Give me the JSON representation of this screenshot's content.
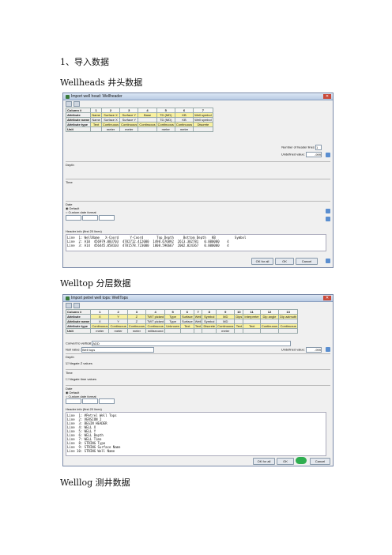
{
  "headings": {
    "import": "1、导入数据",
    "wellheads": "Wellheads 井头数据",
    "welltop": "Welltop 分层数据",
    "welllog": "Welllog 测井数据"
  },
  "dlg1": {
    "title": "Import well head: Wellheader",
    "grid": {
      "col_label": "Column #",
      "cols": [
        "1",
        "2",
        "3",
        "4",
        "5",
        "6",
        "7"
      ],
      "attr_label": "Attribute",
      "attrs": [
        "Name",
        "Surface X",
        "Surface Y",
        "Base",
        "TD (MD)",
        "KB",
        "Well symbol"
      ],
      "name_label": "Attribute name",
      "names": [
        "Name",
        "Surface X",
        "Surface Y",
        "",
        "TD (MD)",
        "KB",
        "Well symbol"
      ],
      "type_label": "Attribute type",
      "types": [
        "Text",
        "Continuous",
        "Continuous",
        "Continuous",
        "Continuous",
        "Continuous",
        "Discrete"
      ],
      "unit_label": "Unit",
      "units": [
        "",
        "meter",
        "meter",
        "",
        "meter",
        "meter",
        ""
      ]
    },
    "header_lines_label": "Number of header lines",
    "header_lines_value": "1",
    "undefined_label": "Undefined value:",
    "undefined_value": "-999",
    "depth_label": "Depth",
    "time_label": "Time",
    "date_label": "Date",
    "default_label": "Default",
    "custom_date_label": "Custom date format",
    "header_info": "Header info (first 20 lines)",
    "lines": [
      "Line  1: WellName   X-Coord      Y-Coord       Top_Depth     Bottom Depth   KB          Symbol",
      "Line  2: A10  456979.083703  4782712.412000  1498.676892  2613.302781   0.000000    4",
      "Line  3: A14  456445.058103  4781578.723000  1808.596667  2002.024367   0.000000    4"
    ],
    "ok_for_all": "OK for all",
    "ok": "OK",
    "cancel": "Cancel"
  },
  "dlg2": {
    "title": "Import petrel well tops: WellTops",
    "grid": {
      "col_label": "Column #",
      "cols": [
        "1",
        "2",
        "3",
        "4",
        "5",
        "6",
        "7",
        "8",
        "9",
        "10",
        "11",
        "12",
        "13"
      ],
      "attr_label": "Attribute",
      "attrs": [
        "X",
        "Y",
        "Z",
        "TWT picked",
        "Type",
        "Surface",
        "Well",
        "Symbol",
        "MD",
        "Dips",
        "Interpreter",
        "Dip angle",
        "Dip azimuth"
      ],
      "name_label": "Attribute name",
      "names": [
        "X",
        "Y",
        "Z",
        "TWT picked",
        "Type",
        "Surface",
        "Well",
        "Symbol",
        "MD",
        "",
        "",
        "",
        ""
      ],
      "type_label": "Attribute type",
      "types": [
        "Continuous",
        "Continuous",
        "Continuous",
        "Continuous",
        "Unknown",
        "Text",
        "Text",
        "Discrete",
        "Continuous",
        "Text",
        "Text",
        "Continuous",
        "Continuous"
      ],
      "unit_label": "Unit",
      "units": [
        "meter",
        "meter",
        "meter",
        "millisecond",
        "",
        "",
        "",
        "",
        "meter",
        "",
        "",
        "",
        ""
      ]
    },
    "convert_label": "Convert to vertical",
    "convert_value": "ADD",
    "null_label": "Null value:",
    "null_value": "Well tops",
    "undefined_label": "Undefined value:",
    "undefined_value": "-999",
    "depth_label": "Depth",
    "negate_z_label": "Negate Z values",
    "time_label": "Time",
    "negate_time_label": "Negate time values",
    "date_label": "Date",
    "default_label": "Default",
    "custom_date_label": "Custom date format",
    "header_info": "Header info (first 20 lines)",
    "lines": [
      "Line  1: #Petrel Well Tops",
      "Line  2: VERSION 2",
      "Line  3: BEGIN HEADER",
      "Line  4: WELL X",
      "Line  5: WELL Y",
      "Line  6: WELL Depth",
      "Line  7: WELL Time",
      "Line  8: STRING Type",
      "Line  9: STRING Surface Name",
      "Line 10: STRING Well Name"
    ],
    "ok_for_all": "OK for all",
    "ok": "OK",
    "cancel": "Cancel"
  }
}
